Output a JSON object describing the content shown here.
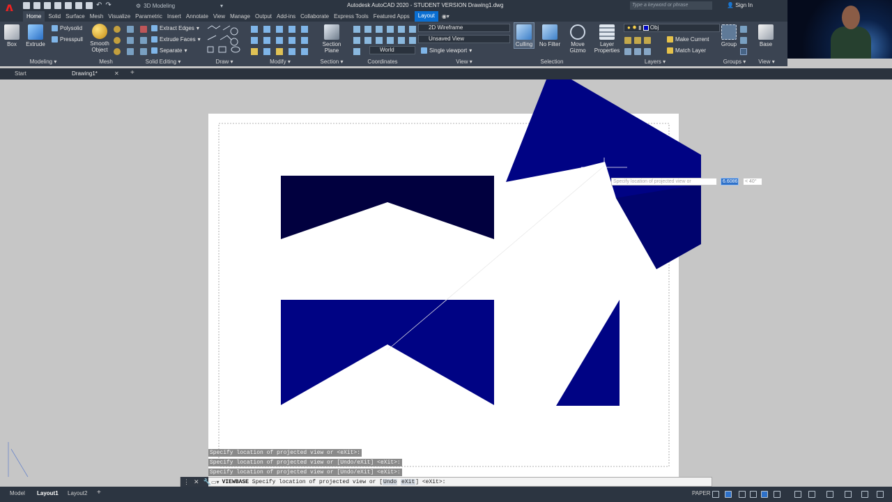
{
  "app": {
    "title": "Autodesk AutoCAD 2020 - STUDENT VERSION   Drawing1.dwg",
    "workspace": "3D Modeling",
    "search_placeholder": "Type a keyword or phrase",
    "signin": "Sign In",
    "logo": "A"
  },
  "tabs": [
    "Home",
    "Solid",
    "Surface",
    "Mesh",
    "Visualize",
    "Parametric",
    "Insert",
    "Annotate",
    "View",
    "Manage",
    "Output",
    "Add-ins",
    "Collaborate",
    "Express Tools",
    "Featured Apps",
    "Layout"
  ],
  "ribbon": {
    "modeling": {
      "box": "Box",
      "extrude": "Extrude",
      "panel": "Modeling ▾"
    },
    "solid_small": {
      "polysolid": "Polysolid",
      "presspull": "Presspull"
    },
    "mesh": {
      "smooth_object": "Smooth Object",
      "panel": "Mesh"
    },
    "solid_editing": {
      "extract_edges": "Extract Edges",
      "extrude_faces": "Extrude Faces",
      "separate": "Separate",
      "panel": "Solid Editing ▾"
    },
    "draw_panel": "Draw ▾",
    "modify_panel": "Modify ▾",
    "section": {
      "section_plane": "Section Plane",
      "panel": "Section ▾"
    },
    "coordinates": {
      "world": "World",
      "panel": "Coordinates"
    },
    "view": {
      "visual_style": "2D Wireframe",
      "named_view": "Unsaved View",
      "viewport": "Single viewport",
      "panel": "View ▾"
    },
    "selection": {
      "culling": "Culling",
      "no_filter": "No Filter",
      "move_gizmo": "Move Gizmo",
      "panel": "Selection"
    },
    "layers": {
      "layer_properties": "Layer Properties",
      "layer_name": "Obj",
      "make_current": "Make Current",
      "match_layer": "Match Layer",
      "panel": "Layers ▾"
    },
    "groups": {
      "group": "Group",
      "panel": "Groups ▾"
    },
    "base": {
      "base": "Base",
      "panel": "View ▾"
    }
  },
  "doc_tabs": {
    "start": "Start",
    "drawing": "Drawing1*",
    "close": "✕",
    "add": "+"
  },
  "dynamic_input": {
    "prompt": "Specify location of projected view or",
    "value": "6.6086",
    "angle": "< 40°"
  },
  "command_history": [
    "Specify location of projected view or <eXit>:",
    "Specify location of projected view or [Undo/eXit] <eXit>:",
    "Specify location of projected view or [Undo/eXit] <eXit>:"
  ],
  "command_line": {
    "command": "VIEWBASE",
    "prompt": "Specify location of projected view or [",
    "opt1": "Undo",
    "opt2": "eXit",
    "suffix": "] <eXit>:"
  },
  "status": {
    "model": "Model",
    "layout1": "Layout1",
    "layout2": "Layout2",
    "add": "+",
    "paper": "PAPER"
  },
  "colors": {
    "dark_fill": "#01003f",
    "blue_fill": "#000384",
    "tab_highlight": "#0a6ed1",
    "paper": "#ffffff",
    "background": "#c6c6c6"
  }
}
